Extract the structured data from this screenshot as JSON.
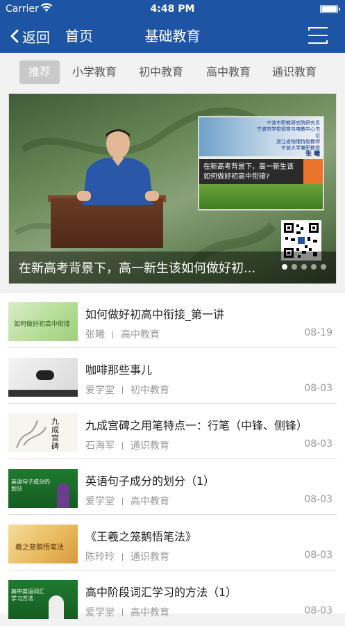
{
  "status_bar": {
    "carrier": "Carrier",
    "time": "4:48 PM"
  },
  "nav": {
    "back_label": "返回",
    "home_label": "首页",
    "title": "基础教育",
    "menu_icon": "hamburger-menu-icon"
  },
  "tabs": [
    {
      "label": "推荐",
      "active": true
    },
    {
      "label": "小学教育",
      "active": false
    },
    {
      "label": "初中教育",
      "active": false
    },
    {
      "label": "高中教育",
      "active": false
    },
    {
      "label": "通识教育",
      "active": false
    }
  ],
  "banner": {
    "caption": "在新高考背景下，高一新生该如何做好初...",
    "slide_count": 5,
    "active_slide": 1,
    "slide_panel_lines": [
      "宁波市职教研究院研究员",
      "宁波市学校德育与电教中心书记",
      "浙江省物理特级教师",
      "宁波大学兼职教授",
      "张 曦"
    ],
    "slide_panel_question": "在新高考背景下，高一新生该如何做好初高中衔接?"
  },
  "list": [
    {
      "title": "如何做好初高中衔接_第一讲",
      "author": "张曦",
      "category": "高中教育",
      "date": "08-19",
      "thumb_text": "如何做好初高中衔接"
    },
    {
      "title": "咖啡那些事儿",
      "author": "爱学堂",
      "category": "初中教育",
      "date": "08-03",
      "thumb_text": ""
    },
    {
      "title": "九成宫碑之用笔特点一：行笔（中锋、侧锋）",
      "author": "石海军",
      "category": "通识教育",
      "date": "08-03",
      "thumb_text": "九成宫碑"
    },
    {
      "title": "英语句子成分的划分（1）",
      "author": "爱学堂",
      "category": "高中教育",
      "date": "08-03",
      "thumb_text": "英语句子成分的划分"
    },
    {
      "title": "《王羲之笼鹅悟笔法》",
      "author": "陈玲玲",
      "category": "通识教育",
      "date": "08-03",
      "thumb_text": "羲之笼鹅悟笔法"
    },
    {
      "title": "高中阶段词汇学习的方法（1）",
      "author": "爱学堂",
      "category": "高中教育",
      "date": "08-03",
      "thumb_text": "高中英语词汇学习方法"
    }
  ]
}
